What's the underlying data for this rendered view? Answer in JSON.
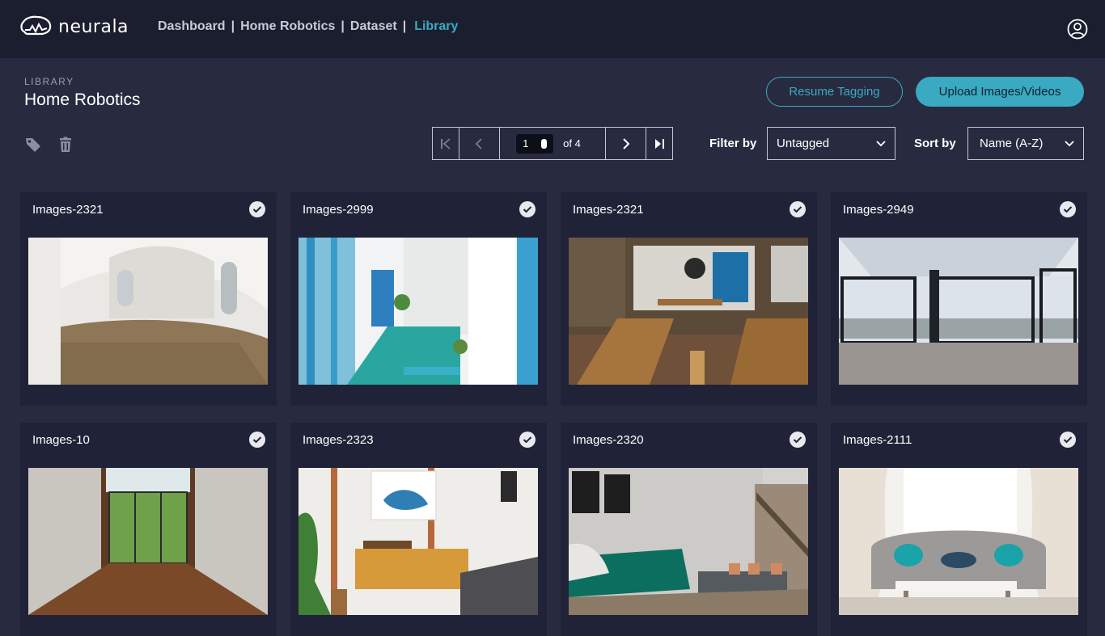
{
  "brand": {
    "name": "neurala"
  },
  "breadcrumb": [
    {
      "label": "Dashboard",
      "active": false
    },
    {
      "label": "Home Robotics",
      "active": false
    },
    {
      "label": "Dataset",
      "active": false
    },
    {
      "label": "Library",
      "active": true
    }
  ],
  "header": {
    "section": "LIBRARY",
    "title": "Home Robotics"
  },
  "actions": {
    "resume": "Resume Tagging",
    "upload": "Upload Images/Videos"
  },
  "pager": {
    "current": "1",
    "of": "of 4"
  },
  "filter": {
    "label": "Filter by",
    "value": "Untagged"
  },
  "sort": {
    "label": "Sort by",
    "value": "Name (A-Z)"
  },
  "cards": [
    {
      "title": "Images-2321",
      "scene": "white-vault-room"
    },
    {
      "title": "Images-2999",
      "scene": "blue-porch"
    },
    {
      "title": "Images-2321",
      "scene": "pub-interior"
    },
    {
      "title": "Images-2949",
      "scene": "sunroom"
    },
    {
      "title": "Images-10",
      "scene": "glass-atrium"
    },
    {
      "title": "Images-2323",
      "scene": "mid-century-living-room"
    },
    {
      "title": "Images-2320",
      "scene": "teal-sofa-lounge"
    },
    {
      "title": "Images-2111",
      "scene": "grey-sofa-living-room"
    }
  ],
  "colors": {
    "accent": "#3aa9c2",
    "topbar": "#1b1e2e",
    "background": "#282b40",
    "card": "#202338"
  }
}
